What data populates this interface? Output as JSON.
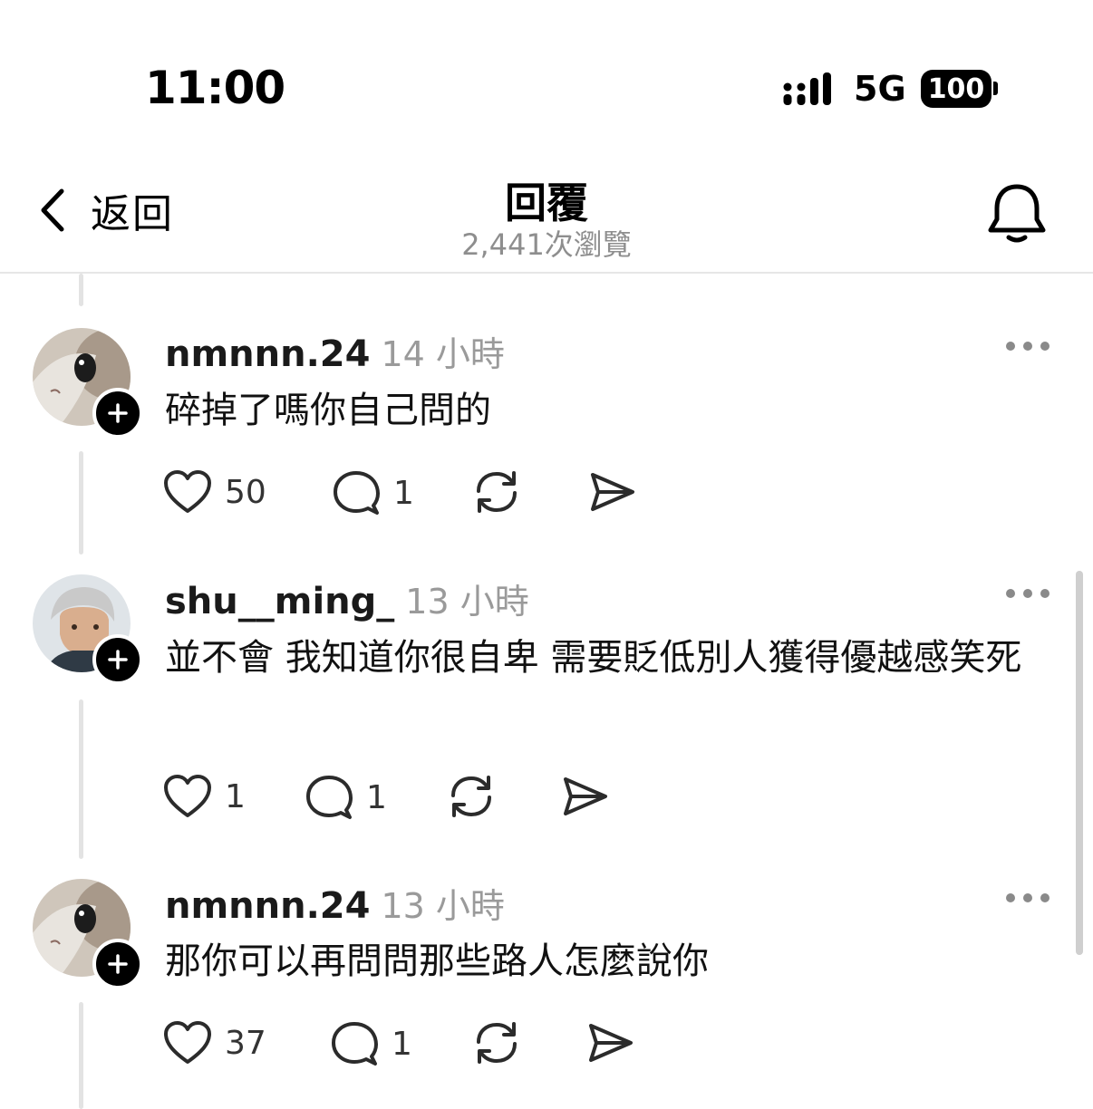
{
  "status_bar": {
    "time": "11:00",
    "network": "5G",
    "battery": "100"
  },
  "header": {
    "back_label": "返回",
    "title": "回覆",
    "views": "2,441次瀏覽"
  },
  "replies": [
    {
      "username": "nmnnn.24",
      "time": "14 小時",
      "text": "碎掉了嗎你自己問的",
      "likes": "50",
      "comments": "1",
      "avatar": "cat-avatar"
    },
    {
      "username": "shu__ming_",
      "time": "13 小時",
      "text": "並不會 我知道你很自卑 需要貶低別人獲得優越感笑死",
      "likes": "1",
      "comments": "1",
      "avatar": "person-avatar"
    },
    {
      "username": "nmnnn.24",
      "time": "13 小時",
      "text": "那你可以再問問那些路人怎麼說你",
      "likes": "37",
      "comments": "1",
      "avatar": "cat-avatar"
    }
  ]
}
